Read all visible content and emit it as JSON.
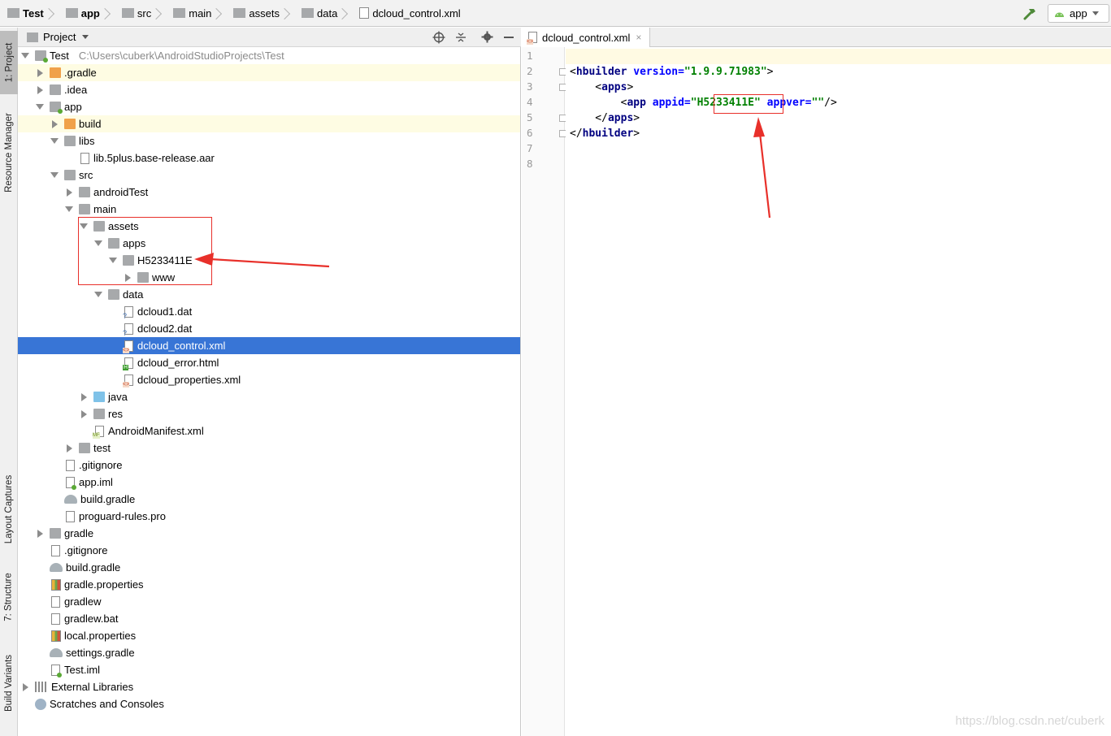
{
  "breadcrumb": [
    "Test",
    "app",
    "src",
    "main",
    "assets",
    "data",
    "dcloud_control.xml"
  ],
  "run_config": "app",
  "side_tabs": {
    "project": "1: Project",
    "resource_manager": "Resource Manager",
    "layout_captures": "Layout Captures",
    "structure": "7: Structure",
    "build_variants": "Build Variants"
  },
  "project_panel": {
    "title": "Project"
  },
  "tree": {
    "root_label": "Test",
    "root_path": "C:\\Users\\cuberk\\AndroidStudioProjects\\Test",
    "gradle_hidden": ".gradle",
    "idea": ".idea",
    "app": "app",
    "build": "build",
    "libs": "libs",
    "aar": "lib.5plus.base-release.aar",
    "src": "src",
    "android_test": "androidTest",
    "main": "main",
    "assets": "assets",
    "apps": "apps",
    "app_id": "H5233411E",
    "www": "www",
    "data": "data",
    "dcloud1": "dcloud1.dat",
    "dcloud2": "dcloud2.dat",
    "dcloud_control": "dcloud_control.xml",
    "dcloud_error": "dcloud_error.html",
    "dcloud_properties": "dcloud_properties.xml",
    "java": "java",
    "res": "res",
    "manifest": "AndroidManifest.xml",
    "test": "test",
    "app_gitignore": ".gitignore",
    "app_iml": "app.iml",
    "app_build_gradle": "build.gradle",
    "proguard": "proguard-rules.pro",
    "gradle_dir": "gradle",
    "root_gitignore": ".gitignore",
    "root_build_gradle": "build.gradle",
    "gradle_properties": "gradle.properties",
    "gradlew": "gradlew",
    "gradlew_bat": "gradlew.bat",
    "local_properties": "local.properties",
    "settings_gradle": "settings.gradle",
    "test_iml": "Test.iml",
    "external_libraries": "External Libraries",
    "scratches": "Scratches and Consoles"
  },
  "editor": {
    "tab_label": "dcloud_control.xml",
    "line_numbers": [
      "1",
      "2",
      "3",
      "4",
      "5",
      "6",
      "7",
      "8"
    ],
    "code": {
      "l2_open": "<",
      "l2_tag": "hbuilder",
      "l2_attr": " version=",
      "l2_val": "\"1.9.9.71983\"",
      "l2_close": ">",
      "l3_open": "    <",
      "l3_tag": "apps",
      "l3_close": ">",
      "l4_open": "        <",
      "l4_tag": "app",
      "l4_attr1": " appid=",
      "l4_q1": "\"",
      "l4_appid": "H5233411E",
      "l4_q2": "\"",
      "l4_attr2": " appver=",
      "l4_val2": "\"\"",
      "l4_close": "/>",
      "l5_open": "    </",
      "l5_tag": "apps",
      "l5_close": ">",
      "l6_open": "</",
      "l6_tag": "hbuilder",
      "l6_close": ">"
    }
  },
  "watermark": "https://blog.csdn.net/cuberk",
  "colors": {
    "selection": "#3875d6",
    "annotation": "#e8302a",
    "highlight_row": "#fefce3"
  }
}
